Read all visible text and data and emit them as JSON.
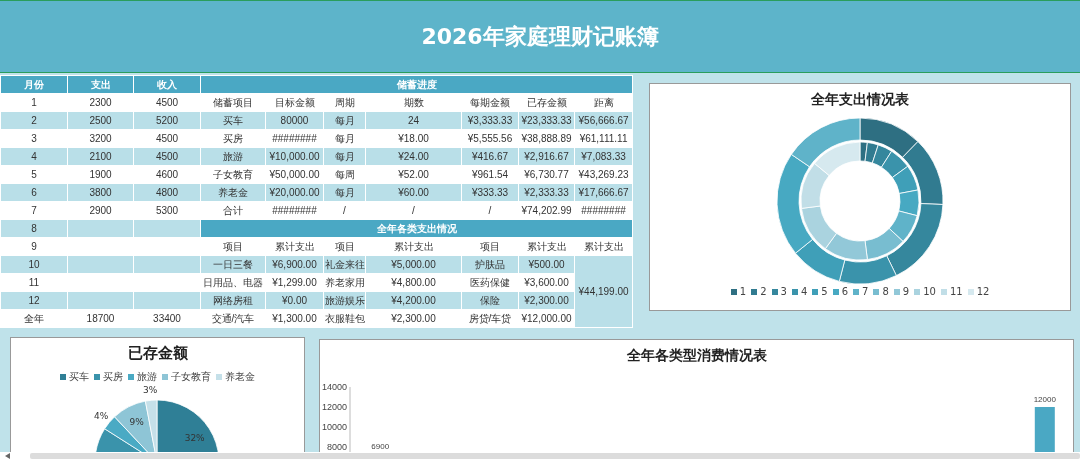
{
  "title": "2026年家庭理财记账簿",
  "monthly": {
    "columns": [
      "月份",
      "支出",
      "收入"
    ],
    "rows": [
      {
        "month": "1",
        "expense": "2300",
        "income": "4500"
      },
      {
        "month": "2",
        "expense": "2500",
        "income": "5200"
      },
      {
        "month": "3",
        "expense": "3200",
        "income": "4500"
      },
      {
        "month": "4",
        "expense": "2100",
        "income": "4500"
      },
      {
        "month": "5",
        "expense": "1900",
        "income": "4600"
      },
      {
        "month": "6",
        "expense": "3800",
        "income": "4800"
      },
      {
        "month": "7",
        "expense": "2900",
        "income": "5300"
      },
      {
        "month": "8"
      },
      {
        "month": "9"
      },
      {
        "month": "10"
      },
      {
        "month": "11"
      },
      {
        "month": "12"
      },
      {
        "month": "全年",
        "expense": "18700",
        "income": "33400"
      }
    ]
  },
  "savings": {
    "title": "储蓄进度",
    "columns": [
      "储蓄项目",
      "目标金额",
      "周期",
      "期数",
      "每期金额",
      "已存金额",
      "距离"
    ],
    "rows": [
      [
        "买车",
        "80000",
        "每月",
        "24",
        "¥3,333.33",
        "¥23,333.33",
        "¥56,666.67"
      ],
      [
        "买房",
        "########",
        "每月",
        "¥18.00",
        "¥5,555.56",
        "¥38,888.89",
        "¥61,111.11"
      ],
      [
        "旅游",
        "¥10,000.00",
        "每月",
        "¥24.00",
        "¥416.67",
        "¥2,916.67",
        "¥7,083.33"
      ],
      [
        "子女教育",
        "¥50,000.00",
        "每周",
        "¥52.00",
        "¥961.54",
        "¥6,730.77",
        "¥43,269.23"
      ],
      [
        "养老金",
        "¥20,000.00",
        "每月",
        "¥60.00",
        "¥333.33",
        "¥2,333.33",
        "¥17,666.67"
      ],
      [
        "合计",
        "########",
        "/",
        "/",
        "/",
        "¥74,202.99",
        "########"
      ]
    ]
  },
  "expenses": {
    "title": "全年各类支出情况",
    "columns": [
      "项目",
      "累计支出",
      "项目",
      "累计支出",
      "项目",
      "累计支出",
      "累计支出"
    ],
    "rows": [
      [
        "一日三餐",
        "¥6,900.00",
        "礼金来往",
        "¥5,000.00",
        "护肤品",
        "¥500.00"
      ],
      [
        "日用品、电器",
        "¥1,299.00",
        "养老家用",
        "¥4,800.00",
        "医药保健",
        "¥3,600.00"
      ],
      [
        "网络房租",
        "¥0.00",
        "旅游娱乐",
        "¥4,200.00",
        "保险",
        "¥2,300.00"
      ],
      [
        "交通/汽车",
        "¥1,300.00",
        "衣服鞋包",
        "¥2,300.00",
        "房贷/车贷",
        "¥12,000.00"
      ]
    ],
    "total": "¥44,199.00"
  },
  "expense_donut": {
    "title": "全年支出情况表",
    "legend": [
      {
        "label": "1",
        "color": "#2e6f82"
      },
      {
        "label": "2",
        "color": "#317b90"
      },
      {
        "label": "3",
        "color": "#35879d"
      },
      {
        "label": "4",
        "color": "#3a93ab"
      },
      {
        "label": "5",
        "color": "#3f9fb8"
      },
      {
        "label": "6",
        "color": "#47a9c2"
      },
      {
        "label": "7",
        "color": "#5fb3c9"
      },
      {
        "label": "8",
        "color": "#78bdd0"
      },
      {
        "label": "9",
        "color": "#92c8d8"
      },
      {
        "label": "10",
        "color": "#aad3df"
      },
      {
        "label": "11",
        "color": "#c1dee7"
      },
      {
        "label": "12",
        "color": "#d6e9ef"
      }
    ]
  },
  "saved_pie": {
    "title": "已存金额",
    "legend": [
      {
        "label": "买车",
        "color": "#2f7f96"
      },
      {
        "label": "买房",
        "color": "#3a93ab"
      },
      {
        "label": "旅游",
        "color": "#4aaac4"
      },
      {
        "label": "子女教育",
        "color": "#8ec5d6"
      },
      {
        "label": "养老金",
        "color": "#c5e0e9"
      }
    ],
    "chart_data": {
      "type": "pie",
      "values": [
        32,
        52,
        4,
        9,
        3
      ],
      "value_labels": [
        "32%",
        null,
        "4%",
        "9%",
        "3%"
      ]
    }
  },
  "category_chart": {
    "title": "全年各类型消费情况表",
    "axis_labels": [
      "14000",
      "12000",
      "10000",
      "8000"
    ],
    "bar_labels": [
      "6900",
      "12000"
    ]
  }
}
